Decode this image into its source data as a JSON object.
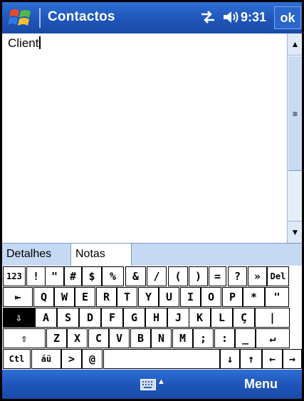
{
  "titlebar": {
    "title": "Contactos",
    "time": "9:31",
    "ok_label": "ok"
  },
  "note": {
    "text": "Client"
  },
  "scrollbar": {
    "up": "▲",
    "grip": "≡",
    "down": "▼"
  },
  "tabs": [
    "Detalhes",
    "Notas"
  ],
  "keyboard": {
    "rows": [
      [
        "123",
        "!",
        "\"",
        "#",
        "$",
        "%",
        "&",
        "/",
        "(",
        ")",
        "=",
        "?",
        "»",
        "Del"
      ],
      [
        "⇤",
        "Q",
        "W",
        "E",
        "R",
        "T",
        "Y",
        "U",
        "I",
        "O",
        "P",
        "*",
        "\""
      ],
      [
        "⇩",
        "A",
        "S",
        "D",
        "F",
        "G",
        "H",
        "J",
        "K",
        "L",
        "Ç",
        "|"
      ],
      [
        "⇧",
        "Z",
        "X",
        "C",
        "V",
        "B",
        "N",
        "M",
        ";",
        ":",
        "_",
        "↵"
      ],
      [
        "Ctl",
        "áü",
        ">",
        "@",
        "",
        "↓",
        "↑",
        "←",
        "→"
      ]
    ]
  },
  "bottombar": {
    "menu_label": "Menu",
    "input_arrow": "▲"
  },
  "icons": {
    "start": "windows-flag-icon",
    "connectivity": "connectivity-icon",
    "volume": "volume-icon",
    "sip": "keyboard-icon"
  }
}
